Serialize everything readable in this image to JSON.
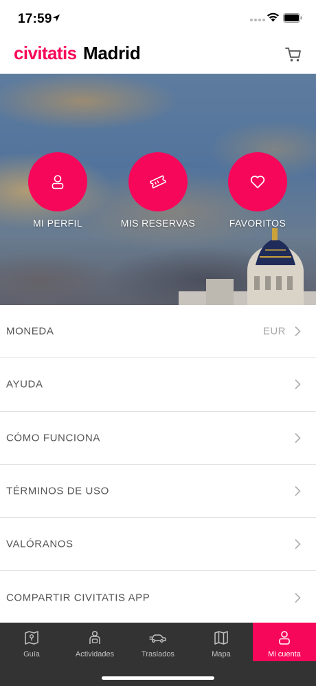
{
  "status_bar": {
    "time": "17:59"
  },
  "header": {
    "brand": "civitatis",
    "city": "Madrid"
  },
  "hero": {
    "actions": [
      {
        "label": "MI PERFIL",
        "icon": "user-icon"
      },
      {
        "label": "MIS RESERVAS",
        "icon": "ticket-icon"
      },
      {
        "label": "FAVORITOS",
        "icon": "heart-icon"
      }
    ]
  },
  "menu": {
    "items": [
      {
        "label": "MONEDA",
        "value": "EUR"
      },
      {
        "label": "AYUDA"
      },
      {
        "label": "CÓMO FUNCIONA"
      },
      {
        "label": "TÉRMINOS DE USO"
      },
      {
        "label": "VALÓRANOS"
      },
      {
        "label": "COMPARTIR CIVITATIS APP"
      }
    ]
  },
  "tabbar": {
    "tabs": [
      {
        "label": "Guía",
        "icon": "map-book-icon"
      },
      {
        "label": "Actividades",
        "icon": "guide-person-icon"
      },
      {
        "label": "Traslados",
        "icon": "car-icon"
      },
      {
        "label": "Mapa",
        "icon": "map-icon"
      },
      {
        "label": "Mi cuenta",
        "icon": "user-icon",
        "active": true
      }
    ]
  },
  "colors": {
    "brand": "#f70759",
    "tabbar_bg": "#333333"
  }
}
